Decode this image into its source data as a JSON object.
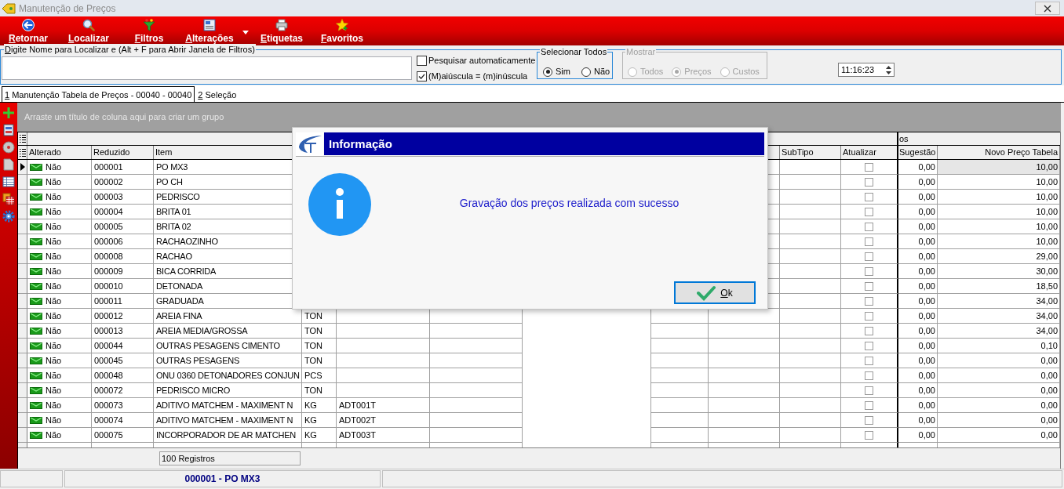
{
  "window": {
    "title": "Manutenção de Preços"
  },
  "toolbar": [
    {
      "label": "Retornar",
      "dropdown": false
    },
    {
      "label": "Localizar",
      "dropdown": false
    },
    {
      "label": "Filtros",
      "dropdown": false
    },
    {
      "label": "Alterações",
      "dropdown": true
    },
    {
      "label": "Etiquetas",
      "dropdown": false
    },
    {
      "label": "Favoritos",
      "dropdown": false
    }
  ],
  "search": {
    "label": "Digite Nome para Localizar e (Alt + F para Abrir Janela de Filtros)"
  },
  "search_options": [
    {
      "label": "Pesquisar automaticamente",
      "checked": false
    },
    {
      "label": "(M)aiúscula = (m)inúscula",
      "checked": true
    }
  ],
  "select_all": {
    "title": "Selecionar Todos",
    "options": [
      {
        "label": "Sim",
        "selected": true
      },
      {
        "label": "Não",
        "selected": false
      }
    ]
  },
  "show": {
    "title": "Mostrar",
    "disabled": true,
    "options": [
      {
        "label": "Todos",
        "selected": false
      },
      {
        "label": "Preços",
        "selected": true
      },
      {
        "label": "Custos",
        "selected": false
      }
    ]
  },
  "time": {
    "value": "11:16:23"
  },
  "tabs": [
    {
      "label": "1 Manutenção Tabela de Preços - 00040 - 00040",
      "selected": true
    },
    {
      "label": "2 Seleção",
      "selected": false
    }
  ],
  "grid": {
    "group_hint": "Arraste um título de coluna aqui para criar um grupo",
    "band_caption": "os",
    "columns": [
      "Alterado",
      "Reduzido",
      "Item",
      "SubTipo",
      "Atualizar",
      "Sugestão",
      "Novo Preço Tabela"
    ],
    "rows": [
      {
        "selected": true,
        "alterado": "Não",
        "reduzido": "000001",
        "item": "PO MX3",
        "atualizar": false,
        "sugestao": "0,00",
        "novo_preco_tabela": "10,00"
      },
      {
        "selected": false,
        "alterado": "Não",
        "reduzido": "000002",
        "item": "PO CH",
        "atualizar": false,
        "sugestao": "0,00",
        "novo_preco_tabela": "10,00"
      },
      {
        "selected": false,
        "alterado": "Não",
        "reduzido": "000003",
        "item": "PEDRISCO",
        "atualizar": false,
        "sugestao": "0,00",
        "novo_preco_tabela": "10,00"
      },
      {
        "selected": false,
        "alterado": "Não",
        "reduzido": "000004",
        "item": "BRITA 01",
        "atualizar": false,
        "sugestao": "0,00",
        "novo_preco_tabela": "10,00"
      },
      {
        "selected": false,
        "alterado": "Não",
        "reduzido": "000005",
        "item": "BRITA 02",
        "atualizar": false,
        "sugestao": "0,00",
        "novo_preco_tabela": "10,00"
      },
      {
        "selected": false,
        "alterado": "Não",
        "reduzido": "000006",
        "item": "RACHAOZINHO",
        "atualizar": false,
        "sugestao": "0,00",
        "novo_preco_tabela": "10,00"
      },
      {
        "selected": false,
        "alterado": "Não",
        "reduzido": "000008",
        "item": "RACHAO",
        "atualizar": false,
        "sugestao": "0,00",
        "novo_preco_tabela": "29,00"
      },
      {
        "selected": false,
        "alterado": "Não",
        "reduzido": "000009",
        "item": "BICA CORRIDA",
        "atualizar": false,
        "sugestao": "0,00",
        "novo_preco_tabela": "30,00"
      },
      {
        "selected": false,
        "alterado": "Não",
        "reduzido": "000010",
        "item": "DETONADA",
        "atualizar": false,
        "sugestao": "0,00",
        "novo_preco_tabela": "18,50"
      },
      {
        "selected": false,
        "alterado": "Não",
        "reduzido": "000011",
        "item": "GRADUADA",
        "atualizar": false,
        "sugestao": "0,00",
        "novo_preco_tabela": "34,00"
      },
      {
        "selected": false,
        "alterado": "Não",
        "reduzido": "000012",
        "item": "AREIA FINA",
        "column_4": "TON",
        "atualizar": false,
        "sugestao": "0,00",
        "novo_preco_tabela": "34,00"
      },
      {
        "selected": false,
        "alterado": "Não",
        "reduzido": "000013",
        "item": "AREIA MEDIA/GROSSA",
        "column_4": "TON",
        "atualizar": false,
        "sugestao": "0,00",
        "novo_preco_tabela": "34,00"
      },
      {
        "selected": false,
        "alterado": "Não",
        "reduzido": "000044",
        "item": "OUTRAS PESAGENS CIMENTO",
        "column_4": "TON",
        "atualizar": false,
        "sugestao": "0,00",
        "novo_preco_tabela": "0,10"
      },
      {
        "selected": false,
        "alterado": "Não",
        "reduzido": "000045",
        "item": "OUTRAS PESAGENS",
        "column_4": "TON",
        "atualizar": false,
        "sugestao": "0,00",
        "novo_preco_tabela": "0,00"
      },
      {
        "selected": false,
        "alterado": "Não",
        "reduzido": "000048",
        "item": "ONU 0360 DETONADORES CONJUN",
        "column_4": "PCS",
        "atualizar": false,
        "sugestao": "0,00",
        "novo_preco_tabela": "0,00"
      },
      {
        "selected": false,
        "alterado": "Não",
        "reduzido": "000072",
        "item": "PEDRISCO MICRO",
        "column_4": "TON",
        "atualizar": false,
        "sugestao": "0,00",
        "novo_preco_tabela": "0,00"
      },
      {
        "selected": false,
        "alterado": "Não",
        "reduzido": "000073",
        "item": "ADITIVO MATCHEM - MAXIMENT N",
        "column_4": "KG",
        "column_5": "ADT001T",
        "atualizar": false,
        "sugestao": "0,00",
        "novo_preco_tabela": "0,00"
      },
      {
        "selected": false,
        "alterado": "Não",
        "reduzido": "000074",
        "item": "ADITIVO MATCHEM - MAXIMENT N",
        "column_4": "KG",
        "column_5": "ADT002T",
        "atualizar": false,
        "sugestao": "0,00",
        "novo_preco_tabela": "0,00"
      },
      {
        "selected": false,
        "alterado": "Não",
        "reduzido": "000075",
        "item": "INCORPORADOR DE AR MATCHEN",
        "column_4": "KG",
        "column_5": "ADT003T",
        "atualizar": false,
        "sugestao": "0,00",
        "novo_preco_tabela": "0,00"
      }
    ],
    "record_count": "100 Registros"
  },
  "dialog": {
    "title": "Informação",
    "message": "Gravação dos preços realizada com sucesso",
    "button": "Ok"
  },
  "status_bar": {
    "current_item": "000001 - PO MX3"
  }
}
